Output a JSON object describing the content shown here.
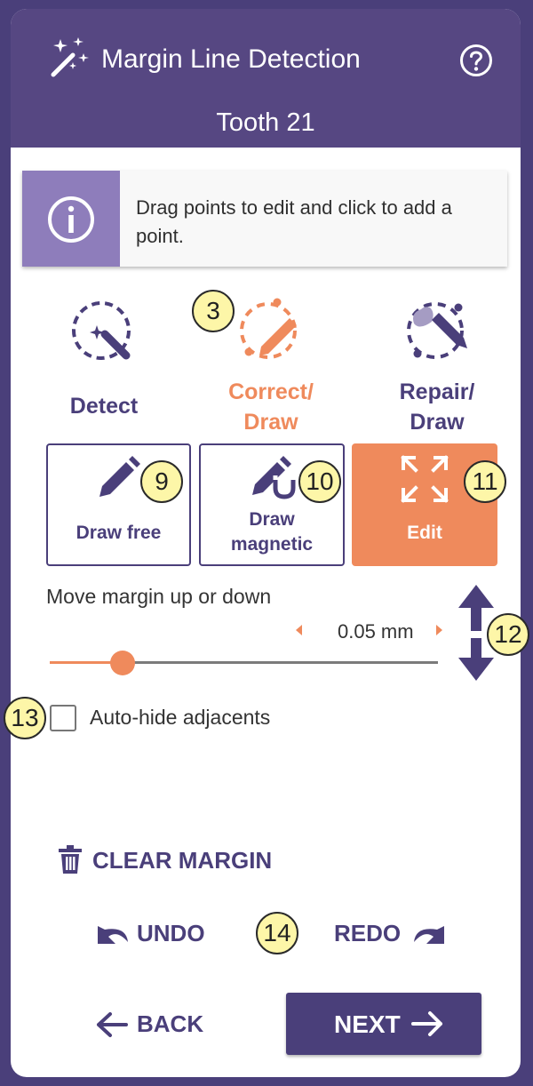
{
  "header": {
    "title": "Margin Line Detection",
    "subtitle": "Tooth 21"
  },
  "info": {
    "message": "Drag points to edit and click to add a point."
  },
  "modes": [
    {
      "label": "Detect",
      "color": "#4a3f7a"
    },
    {
      "label": "Correct/ Draw",
      "line1": "Correct/",
      "line2": "Draw",
      "color": "#ef8a5c"
    },
    {
      "label": "Repair/ Draw",
      "line1": "Repair/",
      "line2": "Draw",
      "color": "#4a3f7a"
    }
  ],
  "tools": [
    {
      "label": "Draw free"
    },
    {
      "label": "Draw magnetic",
      "line1": "Draw",
      "line2": "magnetic"
    },
    {
      "label": "Edit",
      "active": true
    }
  ],
  "margin": {
    "label": "Move margin up or down",
    "value": "0.05 mm",
    "slider_fraction": 0.19
  },
  "auto_hide": {
    "label": "Auto-hide adjacents",
    "checked": false
  },
  "actions": {
    "clear": "CLEAR MARGIN",
    "undo": "UNDO",
    "redo": "REDO",
    "back": "BACK",
    "next": "NEXT"
  },
  "badges": {
    "b3": "3",
    "b9": "9",
    "b10": "10",
    "b11": "11",
    "b12": "12",
    "b13": "13",
    "b14": "14"
  },
  "colors": {
    "primary": "#4a3f7a",
    "accent": "#ef8a5c",
    "info": "#8e7dbb"
  }
}
